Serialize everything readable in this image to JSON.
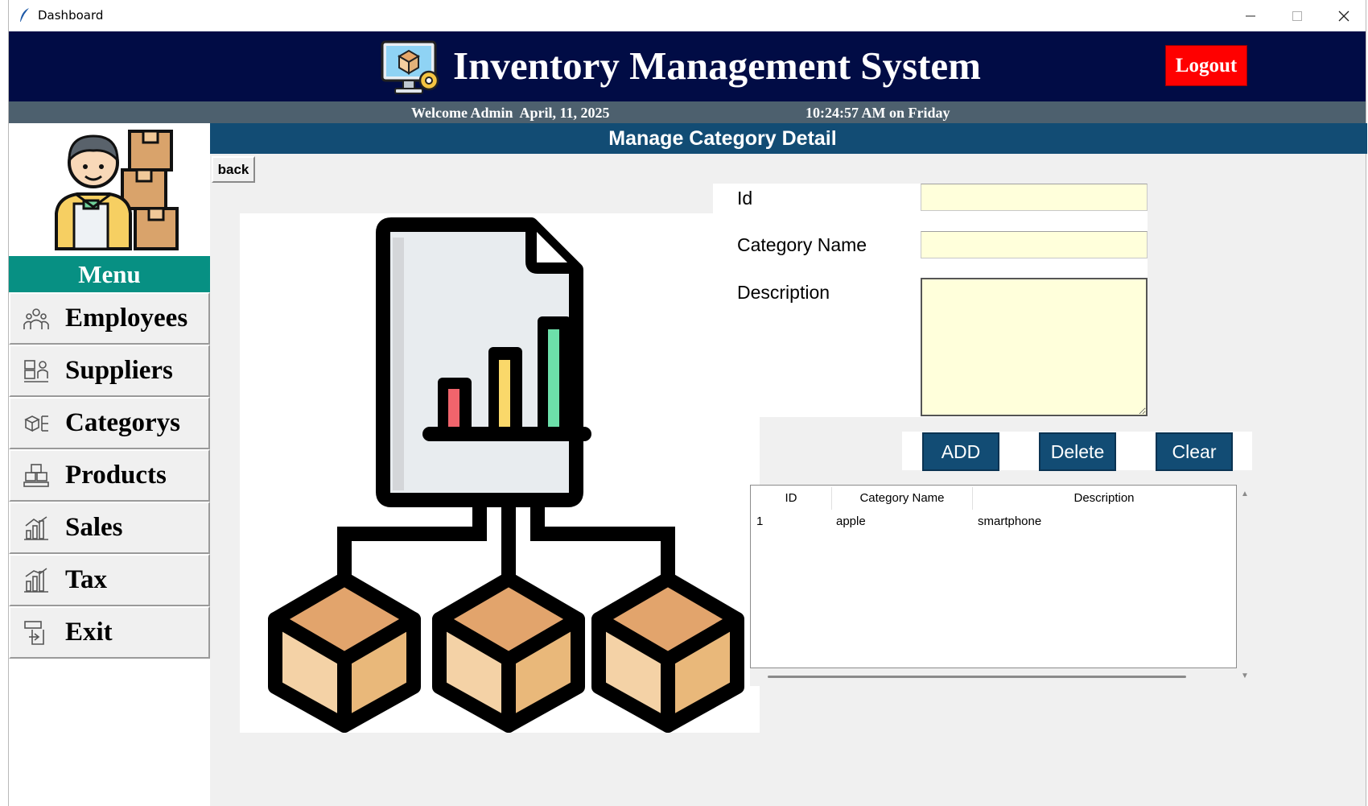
{
  "window": {
    "title": "Dashboard",
    "controls": [
      "minimize",
      "maximize",
      "close"
    ]
  },
  "header": {
    "title": "Inventory Management System",
    "logout_label": "Logout",
    "logo_icon": "computer-gear-box-icon"
  },
  "subheader": {
    "welcome": "Welcome Admin  April, 11, 2025",
    "clock": "10:24:57 AM on Friday"
  },
  "sidebar": {
    "avatar_icon": "delivery-person-boxes-icon",
    "menu_title": "Menu",
    "items": [
      {
        "label": "Employees",
        "icon": "employees-icon"
      },
      {
        "label": "Suppliers",
        "icon": "suppliers-icon"
      },
      {
        "label": "Categorys",
        "icon": "categories-icon"
      },
      {
        "label": "Products",
        "icon": "products-icon"
      },
      {
        "label": "Sales",
        "icon": "sales-icon"
      },
      {
        "label": "Tax",
        "icon": "tax-icon"
      },
      {
        "label": "Exit",
        "icon": "exit-icon"
      }
    ]
  },
  "main": {
    "section_title": "Manage Category Detail",
    "back_label": "back",
    "illustration": "category-hierarchy-illustration",
    "form": {
      "id_label": "Id",
      "id_value": "",
      "name_label": "Category Name",
      "name_value": "",
      "description_label": "Description",
      "description_value": ""
    },
    "buttons": {
      "add": "ADD",
      "delete": "Delete",
      "clear": "Clear"
    },
    "table": {
      "columns": [
        "ID",
        "Category Name",
        "Description"
      ],
      "rows": [
        [
          "1",
          "apple",
          "smartphone"
        ]
      ]
    }
  },
  "colors": {
    "header_bg": "#010c45",
    "subheader_bg": "#4d606e",
    "menu_head_bg": "#079083",
    "section_bar_bg": "#124c74",
    "logout_bg": "#ff0000",
    "input_bg": "#ffffdb"
  }
}
